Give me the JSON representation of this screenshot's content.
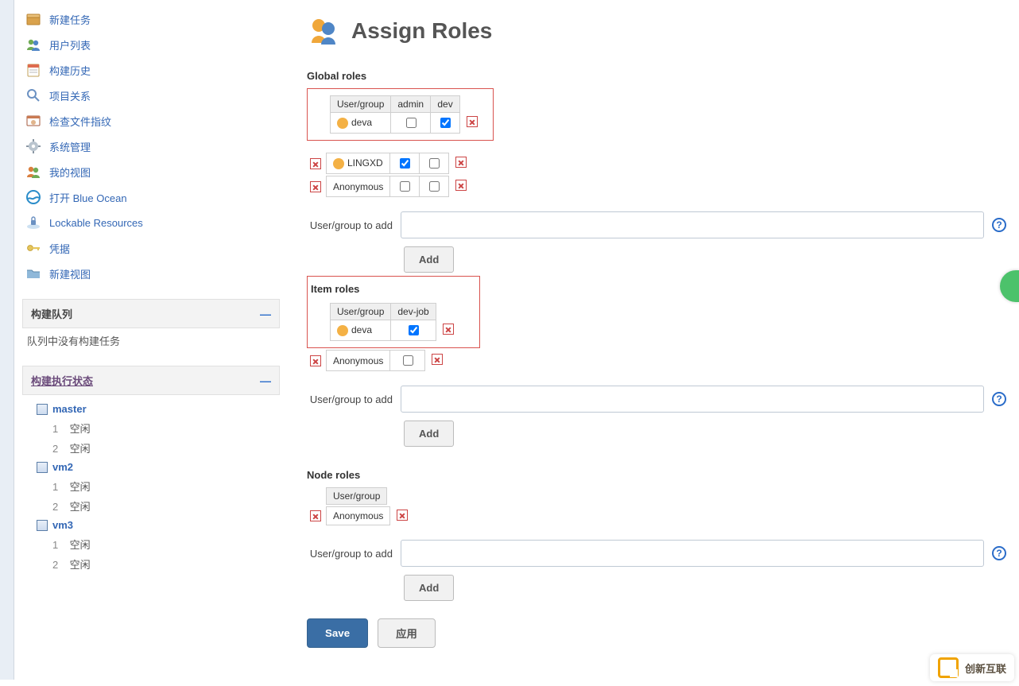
{
  "sidebar": {
    "items": [
      {
        "label": "新建任务",
        "icon": "new-task"
      },
      {
        "label": "用户列表",
        "icon": "users"
      },
      {
        "label": "构建历史",
        "icon": "history"
      },
      {
        "label": "项目关系",
        "icon": "relation"
      },
      {
        "label": "检查文件指纹",
        "icon": "fingerprint"
      },
      {
        "label": "系统管理",
        "icon": "settings"
      },
      {
        "label": "我的视图",
        "icon": "myview"
      },
      {
        "label": "打开 Blue Ocean",
        "icon": "blueocean"
      },
      {
        "label": "Lockable Resources",
        "icon": "lock"
      },
      {
        "label": "凭据",
        "icon": "credentials"
      },
      {
        "label": "新建视图",
        "icon": "newview"
      }
    ],
    "buildQueue": {
      "title": "构建队列",
      "empty": "队列中没有构建任务"
    },
    "execStatus": {
      "title": "构建执行状态",
      "idleLabel": "空闲",
      "nodes": [
        {
          "name": "master",
          "slots": [
            1,
            2
          ]
        },
        {
          "name": "vm2",
          "slots": [
            1,
            2
          ]
        },
        {
          "name": "vm3",
          "slots": [
            1,
            2
          ]
        }
      ]
    }
  },
  "page": {
    "title": "Assign Roles",
    "sections": {
      "global": {
        "title": "Global roles",
        "cols": [
          "User/group",
          "admin",
          "dev"
        ],
        "rows": [
          {
            "name": "deva",
            "admin": false,
            "dev": true,
            "highlight": true
          },
          {
            "name": "LINGXD",
            "admin": true,
            "dev": false
          },
          {
            "name": "Anonymous",
            "admin": false,
            "dev": false
          }
        ],
        "addLabel": "User/group to add",
        "addButton": "Add"
      },
      "item": {
        "title": "Item roles",
        "cols": [
          "User/group",
          "dev-job"
        ],
        "rows": [
          {
            "name": "deva",
            "devjob": true,
            "highlight": true
          },
          {
            "name": "Anonymous",
            "devjob": false
          }
        ],
        "addLabel": "User/group to add",
        "addButton": "Add"
      },
      "node": {
        "title": "Node roles",
        "cols": [
          "User/group"
        ],
        "rows": [
          {
            "name": "Anonymous"
          }
        ],
        "addLabel": "User/group to add",
        "addButton": "Add"
      }
    },
    "save": "Save",
    "apply": "应用"
  },
  "brand": "创新互联"
}
